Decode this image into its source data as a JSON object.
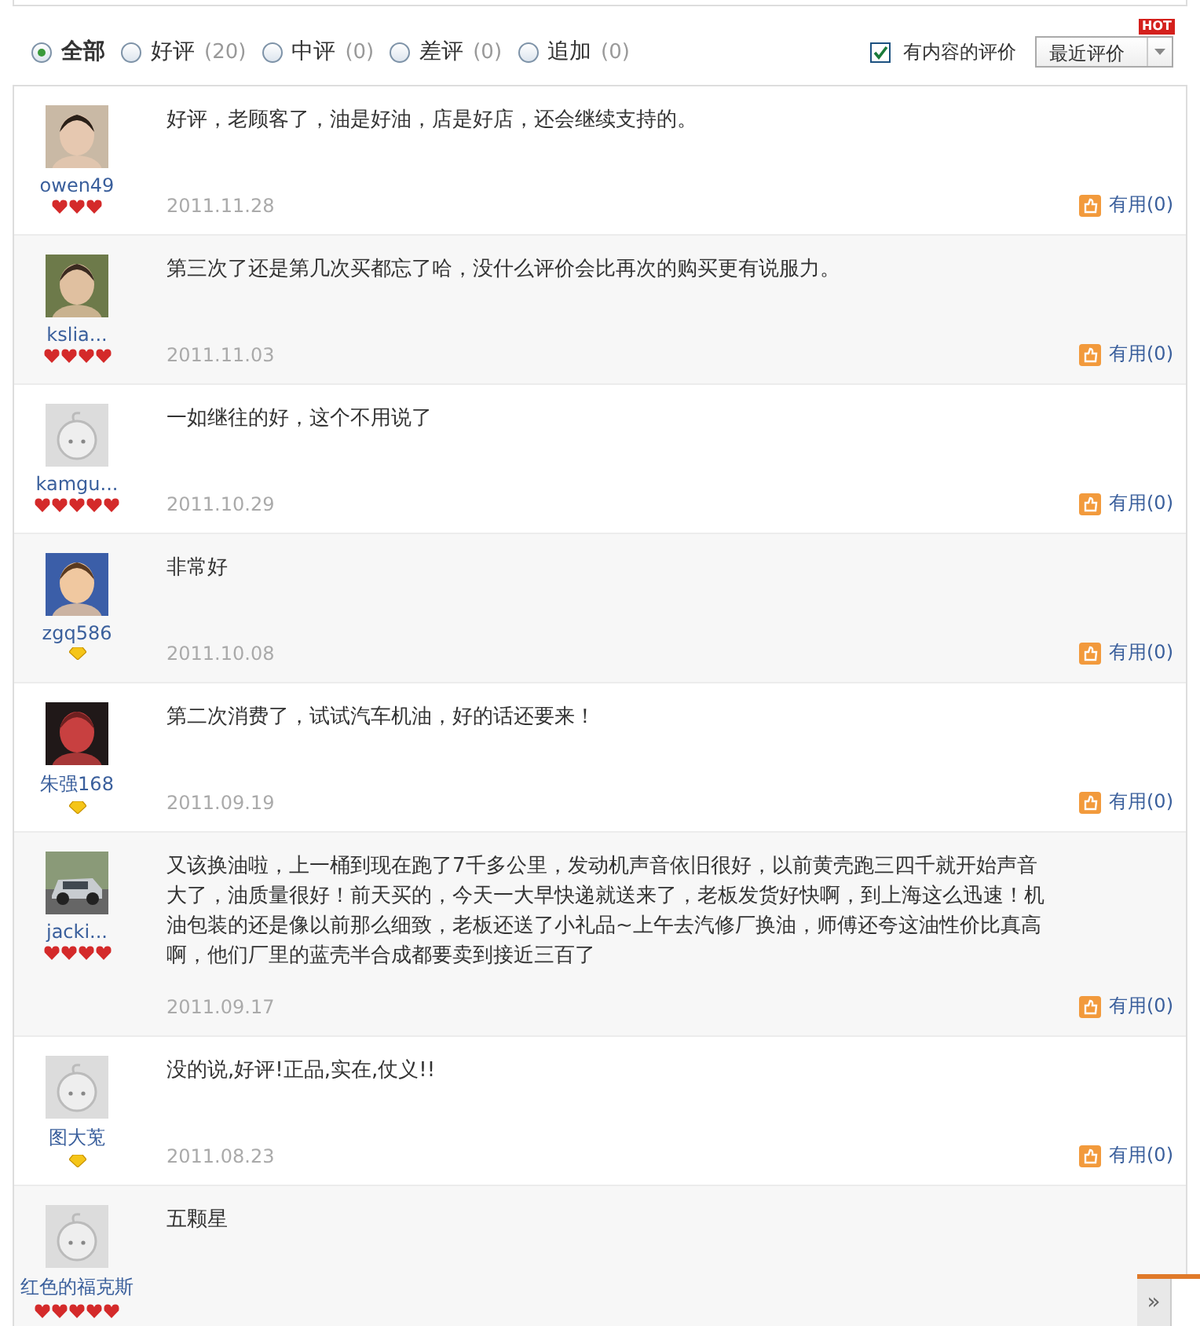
{
  "filters": [
    {
      "label": "全部",
      "selected": true
    },
    {
      "label": "好评",
      "count": "(20)",
      "selected": false
    },
    {
      "label": "中评",
      "count": "(0)",
      "selected": false
    },
    {
      "label": "差评",
      "count": "(0)",
      "selected": false
    },
    {
      "label": "追加",
      "count": "(0)",
      "selected": false
    }
  ],
  "content_only": {
    "label": "有内容的评价",
    "checked": true
  },
  "sort": {
    "value": "最近评价",
    "badge": "HOT"
  },
  "reviews": [
    {
      "name": "owen49",
      "badge": {
        "kind": "heart",
        "stars": 3
      },
      "text": "好评，老顾客了，油是好油，店是好店，还会继续支持的。",
      "date": "2011.11.28",
      "useful": "有用(0)"
    },
    {
      "name": "kslia...",
      "badge": {
        "kind": "heart",
        "stars": 4
      },
      "text": "第三次了还是第几次买都忘了哈，没什么评价会比再次的购买更有说服力。",
      "date": "2011.11.03",
      "useful": "有用(0)"
    },
    {
      "avatar": {
        "kind": "default"
      },
      "name": "kamgu...",
      "badge": {
        "kind": "heart",
        "stars": 5
      },
      "text": "一如继往的好，这个不用说了",
      "date": "2011.10.29",
      "useful": "有用(0)"
    },
    {
      "name": "zgq586",
      "badge": {
        "kind": "diamond"
      },
      "text": "非常好",
      "date": "2011.10.08",
      "useful": "有用(0)"
    },
    {
      "name": "朱强168",
      "badge": {
        "kind": "diamond"
      },
      "text": "第二次消费了，试试汽车机油，好的话还要来！",
      "date": "2011.09.19",
      "useful": "有用(0)"
    },
    {
      "name": "jacki...",
      "badge": {
        "kind": "heart",
        "stars": 4
      },
      "text": "又该换油啦，上一桶到现在跑了7千多公里，发动机声音依旧很好，以前黄壳跑三四千就开始声音大了，油质量很好！前天买的，今天一大早快递就送来了，老板发货好快啊，到上海这么迅速！机油包装的还是像以前那么细致，老板还送了小礼品~上午去汽修厂换油，师傅还夸这油性价比真高啊，他们厂里的蓝壳半合成都要卖到接近三百了",
      "date": "2011.09.17",
      "useful": "有用(0)"
    },
    {
      "avatar": {
        "kind": "default"
      },
      "name": "图大莵",
      "badge": {
        "kind": "diamond"
      },
      "text": "没的说,好评!正品,实在,仗义!!",
      "date": "2011.08.23",
      "useful": "有用(0)"
    },
    {
      "avatar": {
        "kind": "default"
      },
      "name": "红色的福克斯",
      "badge": {
        "kind": "heart",
        "stars": 5
      },
      "text": "五颗星"
    }
  ],
  "float_bar": {
    "toggle": "»"
  }
}
